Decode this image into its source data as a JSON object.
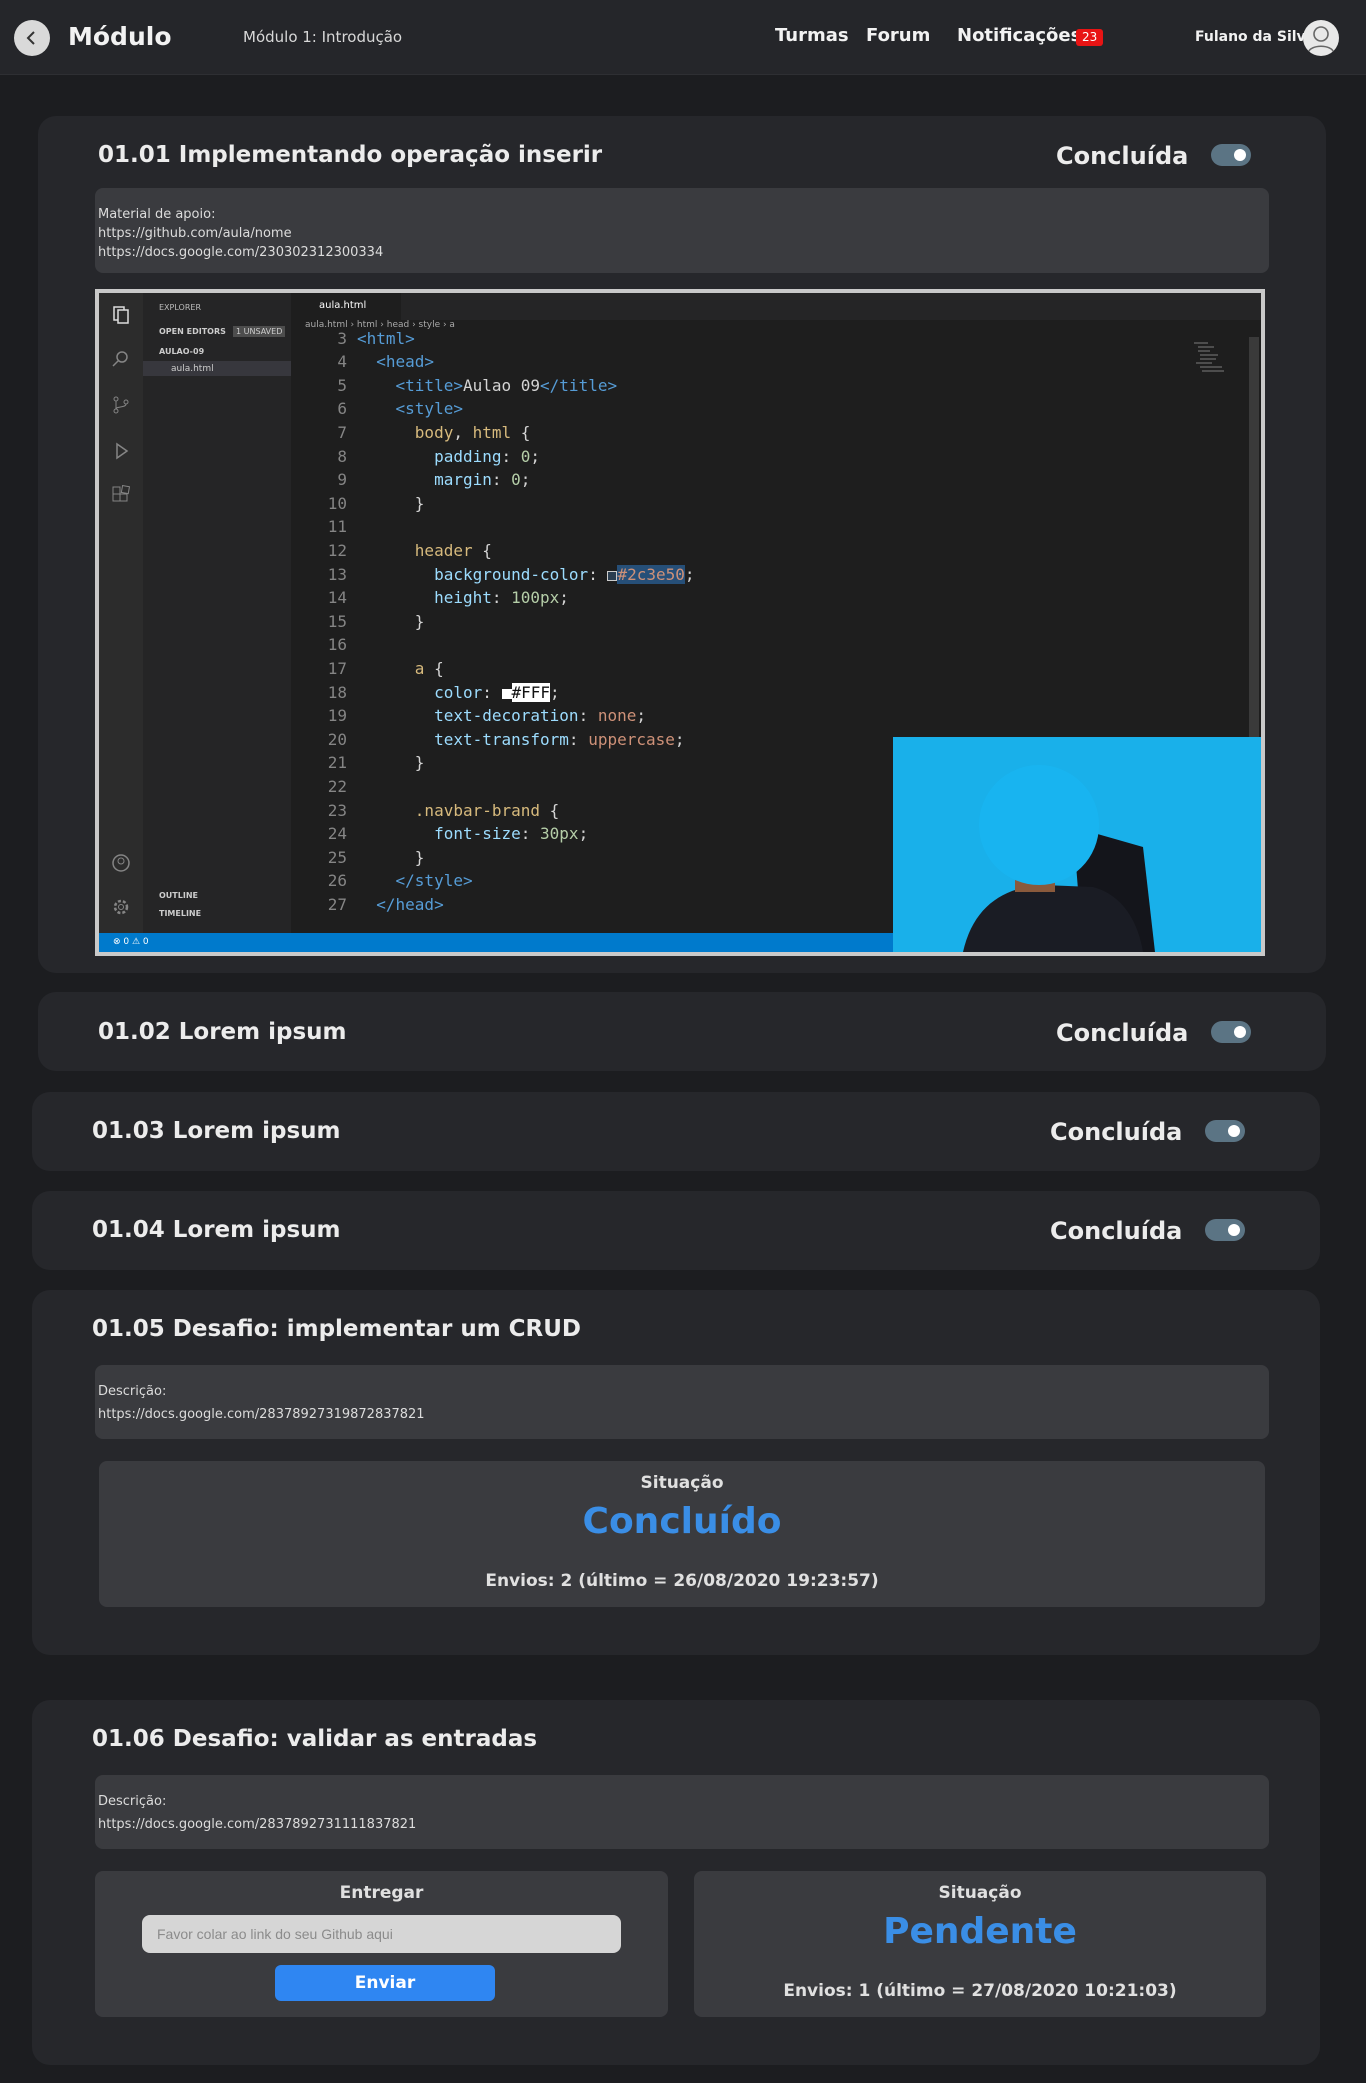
{
  "header": {
    "title": "Módulo",
    "breadcrumb": "Módulo 1: Introdução",
    "nav": {
      "turmas": "Turmas",
      "forum": "Forum",
      "notificacoes": "Notificações"
    },
    "notification_count": "23",
    "user_name": "Fulano da Silva"
  },
  "status_text": "Concluída",
  "lessons": [
    {
      "title": "01.01 Implementando operação inserir",
      "support_label": "Material de apoio:",
      "links": [
        "https://github.com/aula/nome",
        "https://docs.google.com/230302312300334"
      ],
      "completed": true
    },
    {
      "title": "01.02 Lorem ipsum",
      "completed": true
    },
    {
      "title": "01.03 Lorem ipsum",
      "completed": true
    },
    {
      "title": "01.04 Lorem ipsum",
      "completed": true
    }
  ],
  "video": {
    "explorer_header": "EXPLORER",
    "open_editors": "OPEN EDITORS",
    "unsaved": "1 UNSAVED",
    "folder": "AULAO-09",
    "file": "aula.html",
    "outline": "OUTLINE",
    "timeline": "TIMELINE",
    "tab": "aula.html",
    "breadcrumbs": "aula.html  ›  html  ›  head  ›  style  ›  a",
    "status": "⊗ 0 ⚠ 0",
    "line_numbers": [
      "3",
      "4",
      "5",
      "6",
      "7",
      "8",
      "9",
      "10",
      "11",
      "12",
      "13",
      "14",
      "15",
      "16",
      "17",
      "18",
      "19",
      "20",
      "21",
      "22",
      "23",
      "24",
      "25",
      "26",
      "27"
    ]
  },
  "challenges": [
    {
      "title": "01.05 Desafio: implementar um CRUD",
      "desc_label": "Descrição:",
      "desc_link": "https://docs.google.com/28378927319872837821",
      "situation_label": "Situação",
      "situation": "Concluído",
      "sends": "Envios: 2 (último = 26/08/2020 19:23:57)"
    },
    {
      "title": "01.06 Desafio: validar as entradas",
      "desc_label": "Descrição:",
      "desc_link": "https://docs.google.com/2837892731111837821",
      "deliver_label": "Entregar",
      "input_placeholder": "Favor colar ao link do seu Github aqui",
      "send_label": "Enviar",
      "situation_label": "Situação",
      "situation": "Pendente",
      "sends": "Envios: 1 (último = 27/08/2020 10:21:03)"
    }
  ],
  "colors": {
    "accent": "#3a8ee6",
    "button": "#2f86f2",
    "badge": "#e81414",
    "toggle": "#5b7484"
  }
}
